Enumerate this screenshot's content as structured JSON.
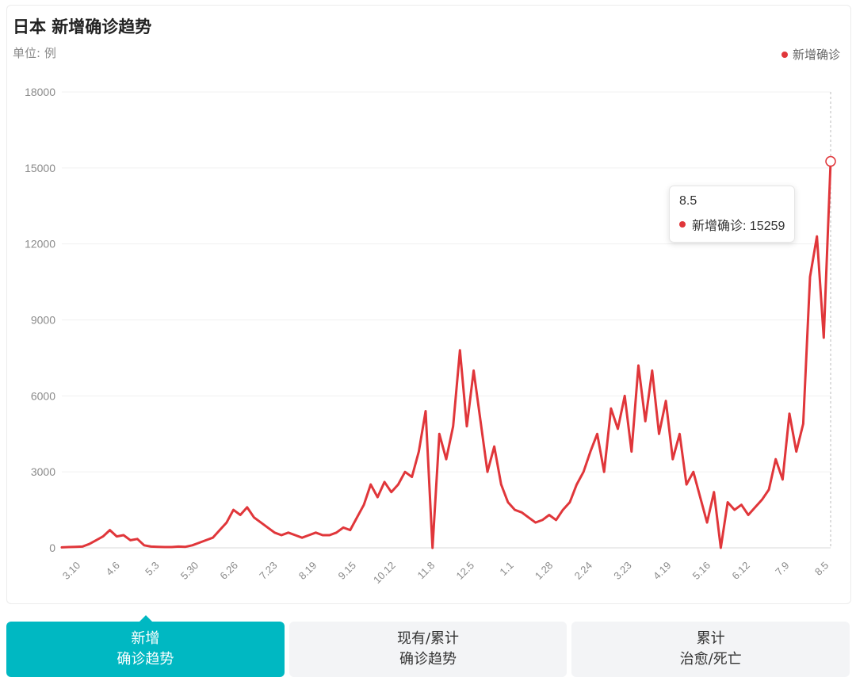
{
  "header": {
    "title": "日本 新增确诊趋势",
    "unit": "单位: 例"
  },
  "colors": {
    "series": "#e0363a",
    "accent": "#00b8c2",
    "grid": "#f0f0f0",
    "axis_text": "#8a8a8a"
  },
  "tooltip": {
    "date": "8.5",
    "label": "新增确诊: 15259"
  },
  "tabs": [
    {
      "line1": "新增",
      "line2": "确诊趋势",
      "active": true
    },
    {
      "line1": "现有/累计",
      "line2": "确诊趋势",
      "active": false
    },
    {
      "line1": "累计",
      "line2": "治愈/死亡",
      "active": false
    }
  ],
  "chart_data": {
    "type": "line",
    "title": "日本 新增确诊趋势",
    "ylabel": "单位: 例",
    "ylim": [
      0,
      18000
    ],
    "yticks": [
      "0",
      "3000",
      "6000",
      "9000",
      "12000",
      "15000",
      "18000"
    ],
    "xticks": [
      "3.10",
      "4.6",
      "5.3",
      "5.30",
      "6.26",
      "7.23",
      "8.19",
      "9.15",
      "10.12",
      "11.8",
      "12.5",
      "1.1",
      "1.28",
      "2.24",
      "3.23",
      "4.19",
      "5.16",
      "6.12",
      "7.9",
      "8.5"
    ],
    "legend": {
      "position": "top-right"
    },
    "grid": true,
    "highlight": {
      "x": "8.5",
      "value": 15259
    },
    "series": [
      {
        "name": "新增确诊",
        "values": [
          20,
          30,
          40,
          50,
          150,
          300,
          450,
          700,
          450,
          500,
          300,
          350,
          100,
          50,
          40,
          30,
          30,
          50,
          40,
          100,
          200,
          300,
          400,
          700,
          1000,
          1500,
          1300,
          1600,
          1200,
          1000,
          800,
          600,
          500,
          600,
          500,
          400,
          500,
          600,
          500,
          500,
          600,
          800,
          700,
          1200,
          1700,
          2500,
          2000,
          2600,
          2200,
          2500,
          3000,
          2800,
          3800,
          5400,
          0,
          4500,
          3500,
          4800,
          7800,
          4800,
          7000,
          5000,
          3000,
          4000,
          2500,
          1800,
          1500,
          1400,
          1200,
          1000,
          1100,
          1300,
          1100,
          1500,
          1800,
          2500,
          3000,
          3800,
          4500,
          3000,
          5500,
          4700,
          6000,
          3800,
          7200,
          5000,
          7000,
          4500,
          5800,
          3500,
          4500,
          2500,
          3000,
          2000,
          1000,
          2200,
          0,
          1800,
          1500,
          1700,
          1300,
          1600,
          1900,
          2300,
          3500,
          2700,
          5300,
          3800,
          4900,
          10700,
          12300,
          8300,
          15259
        ]
      }
    ]
  }
}
